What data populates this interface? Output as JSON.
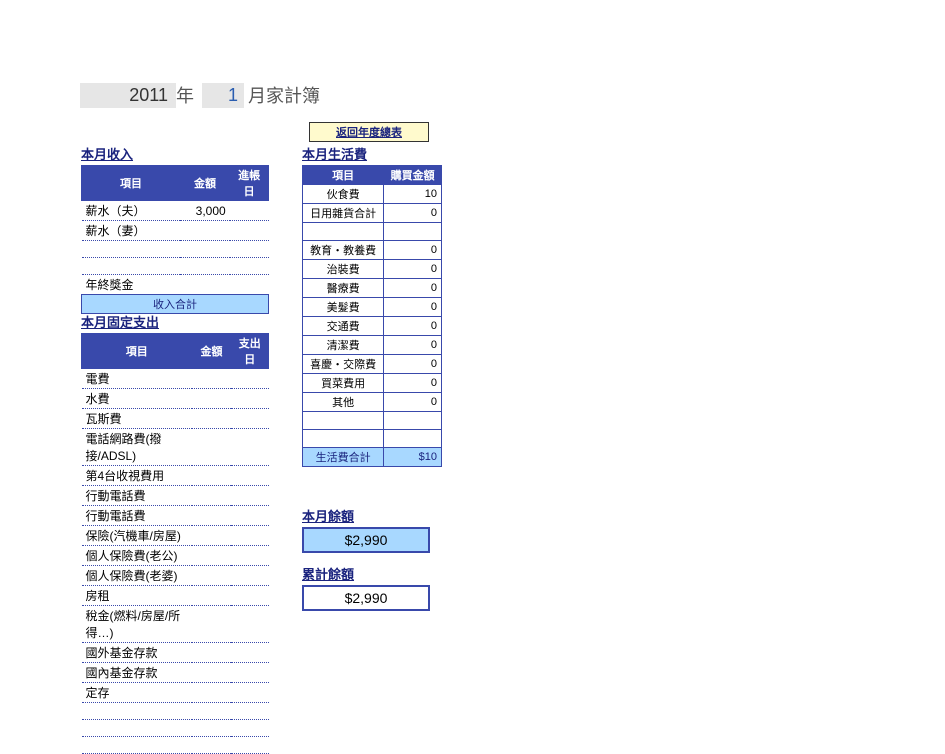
{
  "title": {
    "year": "2011",
    "year_suffix": "年",
    "month": "1",
    "month_suffix": "月家計簿"
  },
  "return_link": "返回年度總表",
  "income": {
    "title": "本月收入",
    "headers": {
      "item": "項目",
      "amount": "金額",
      "date": "進帳日"
    },
    "rows": [
      {
        "item": "薪水（夫）",
        "amount": "3,000",
        "date": ""
      },
      {
        "item": "薪水（妻）",
        "amount": "",
        "date": ""
      },
      {
        "item": "",
        "amount": "",
        "date": ""
      },
      {
        "item": "",
        "amount": "",
        "date": ""
      },
      {
        "item": "年終獎金",
        "amount": "",
        "date": ""
      }
    ],
    "total_label": "收入合計"
  },
  "fixed": {
    "title": "本月固定支出",
    "headers": {
      "item": "項目",
      "amount": "金額",
      "date": "支出日"
    },
    "rows": [
      "電費",
      "水費",
      "瓦斯費",
      "電話網路費(撥接/ADSL)",
      "第4台收視費用",
      "行動電話費",
      "行動電話費",
      "保險(汽機車/房屋)",
      "個人保險費(老公)",
      "個人保險費(老婆)",
      "房租",
      "稅金(燃料/房屋/所得…)",
      "國外基金存款",
      "國內基金存款",
      "定存",
      "",
      "",
      ""
    ]
  },
  "living": {
    "title": "本月生活費",
    "headers": {
      "item": "項目",
      "amount": "購買金額"
    },
    "rows": [
      {
        "item": "伙食費",
        "amount": "10"
      },
      {
        "item": "日用雜貨合計",
        "amount": "0"
      },
      {
        "item": "",
        "amount": ""
      },
      {
        "item": "教育・教養費",
        "amount": "0"
      },
      {
        "item": "治裝費",
        "amount": "0"
      },
      {
        "item": "醫療費",
        "amount": "0"
      },
      {
        "item": "美髮費",
        "amount": "0"
      },
      {
        "item": "交通費",
        "amount": "0"
      },
      {
        "item": "清潔費",
        "amount": "0"
      },
      {
        "item": "喜慶・交際費",
        "amount": "0"
      },
      {
        "item": "買菜費用",
        "amount": "0"
      },
      {
        "item": "其他",
        "amount": "0"
      },
      {
        "item": "",
        "amount": ""
      },
      {
        "item": "",
        "amount": ""
      }
    ],
    "total_label": "生活費合計",
    "total_value": "$10"
  },
  "balance1": {
    "title": "本月餘額",
    "value": "$2,990"
  },
  "balance2": {
    "title": "累計餘額",
    "value": "$2,990"
  }
}
